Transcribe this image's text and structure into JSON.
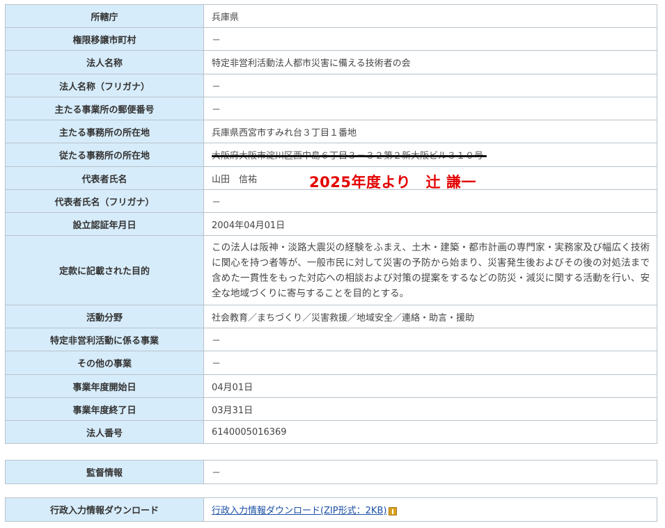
{
  "main_table": {
    "rows": [
      {
        "label": "所轄庁",
        "value": "兵庫県"
      },
      {
        "label": "権限移譲市町村",
        "value": "－"
      },
      {
        "label": "法人名称",
        "value": "特定非営利活動法人都市災害に備える技術者の会"
      },
      {
        "label": "法人名称（フリガナ）",
        "value": "－"
      },
      {
        "label": "主たる事業所の郵便番号",
        "value": "－"
      },
      {
        "label": "主たる事務所の所在地",
        "value": "兵庫県西宮市すみれ台３丁目１番地"
      },
      {
        "label": "従たる事務所の所在地",
        "value": "大阪府大阪市淀川区西中島６丁目３－３２第２新大阪ビル３１０号"
      },
      {
        "label": "代表者氏名",
        "value": "山田　信祐"
      },
      {
        "label": "代表者氏名（フリガナ）",
        "value": "－"
      },
      {
        "label": "設立認証年月日",
        "value": "2004年04月01日"
      },
      {
        "label": "定款に記載された目的",
        "value": "この法人は阪神・淡路大震災の経験をふまえ、土木・建築・都市計画の専門家・実務家及び幅広く技術に関心を持つ者等が、一般市民に対して災害の予防から始まり、災害発生後およびその後の対処法まで含めた一貫性をもった対応への相談および対策の提案をするなどの防災・減災に関する活動を行い、安全な地域づくりに寄与することを目的とする。"
      },
      {
        "label": "活動分野",
        "value": "社会教育／まちづくり／災害救援／地域安全／連絡・助言・援助"
      },
      {
        "label": "特定非営利活動に係る事業",
        "value": "－"
      },
      {
        "label": "その他の事業",
        "value": "－"
      },
      {
        "label": "事業年度開始日",
        "value": "04月01日"
      },
      {
        "label": "事業年度終了日",
        "value": "03月31日"
      },
      {
        "label": "法人番号",
        "value": "6140005016369"
      }
    ]
  },
  "annotation": {
    "text": "2025年度より　辻 謙一",
    "color": "#e30000"
  },
  "supervision": {
    "label": "監督情報",
    "value": "－"
  },
  "download": {
    "label": "行政入力情報ダウンロード",
    "link_text": "行政入力情報ダウンロード(ZIP形式：2KB)",
    "icon": "zip-file-icon"
  },
  "colors": {
    "header_bg": "#d7ecfa",
    "border": "#b8c2cb",
    "link": "#1a4fa3"
  }
}
